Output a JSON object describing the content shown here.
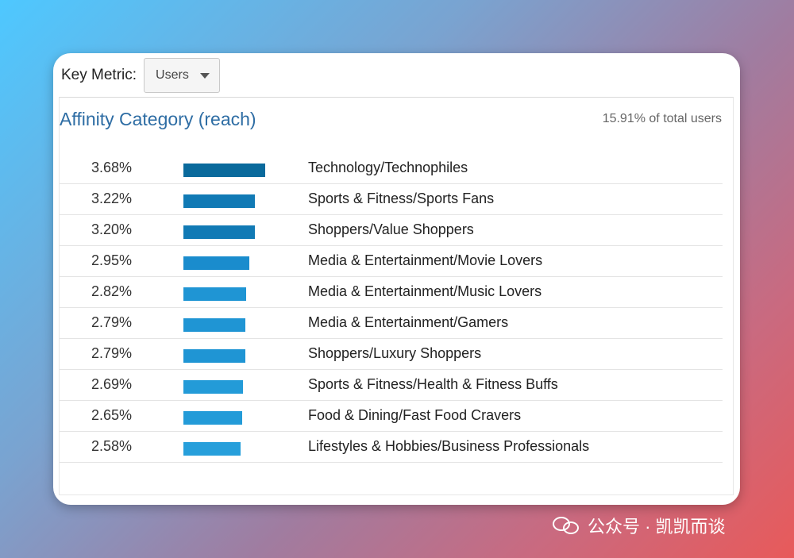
{
  "key_metric": {
    "label": "Key Metric:",
    "selected": "Users"
  },
  "panel": {
    "title": "Affinity Category (reach)",
    "total": "15.91% of total users"
  },
  "rows": [
    {
      "pct": "3.68%",
      "value": 3.68,
      "category": "Technology/Technophiles",
      "color": "#0a6a9c"
    },
    {
      "pct": "3.22%",
      "value": 3.22,
      "category": "Sports & Fitness/Sports Fans",
      "color": "#117ab5"
    },
    {
      "pct": "3.20%",
      "value": 3.2,
      "category": "Shoppers/Value Shoppers",
      "color": "#117ab5"
    },
    {
      "pct": "2.95%",
      "value": 2.95,
      "category": "Media & Entertainment/Movie Lovers",
      "color": "#1a8ccd"
    },
    {
      "pct": "2.82%",
      "value": 2.82,
      "category": "Media & Entertainment/Music Lovers",
      "color": "#1f95d4"
    },
    {
      "pct": "2.79%",
      "value": 2.79,
      "category": "Media & Entertainment/Gamers",
      "color": "#1f95d4"
    },
    {
      "pct": "2.79%",
      "value": 2.79,
      "category": "Shoppers/Luxury Shoppers",
      "color": "#1f95d4"
    },
    {
      "pct": "2.69%",
      "value": 2.69,
      "category": "Sports & Fitness/Health & Fitness Buffs",
      "color": "#239bd8"
    },
    {
      "pct": "2.65%",
      "value": 2.65,
      "category": "Food & Dining/Fast Food Cravers",
      "color": "#239bd8"
    },
    {
      "pct": "2.58%",
      "value": 2.58,
      "category": "Lifestyles & Hobbies/Business Professionals",
      "color": "#279fdb"
    }
  ],
  "watermark": {
    "text": "公众号 · 凯凯而谈",
    "icon": "wechat-icon"
  }
}
